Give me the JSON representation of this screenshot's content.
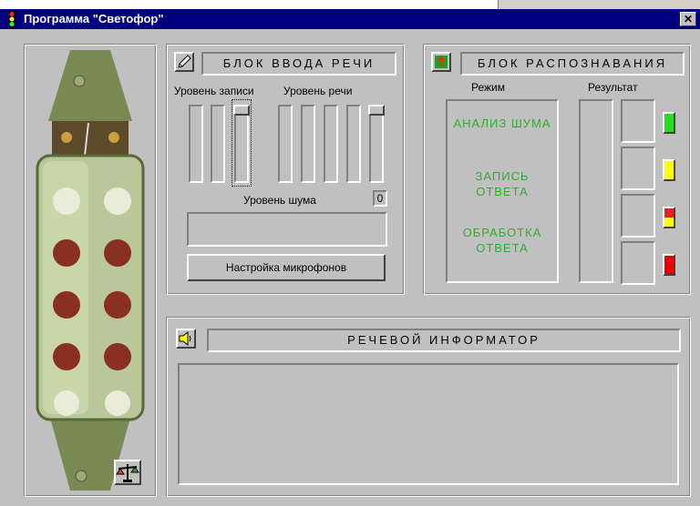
{
  "window": {
    "title": "Программа \"Светофор\"",
    "close_glyph": "✕"
  },
  "speech_input": {
    "header": "БЛОК ВВОДА РЕЧИ",
    "record_level_label": "Уровень записи",
    "speech_level_label": "Уровень речи",
    "noise_level_label": "Уровень шума",
    "noise_value": "0",
    "mic_settings_button": "Настройка микрофонов"
  },
  "recognition": {
    "header": "БЛОК РАСПОЗНАВАНИЯ",
    "mode_label": "Режим",
    "result_label": "Результат",
    "modes": [
      "АНАЛИЗ ШУМА",
      "ЗАПИСЬ ОТВЕТА",
      "ОБРАБОТКА ОТВЕТА"
    ]
  },
  "informer": {
    "header": "РЕЧЕВОЙ ИНФОРМАТОР"
  },
  "colors": {
    "titlebar": "#000080",
    "mode_text": "#33aa33",
    "lamp_green": "#22dd22",
    "lamp_yellow": "#ffff00",
    "lamp_red_yellow": "#e82020",
    "lamp_red": "#e80000"
  },
  "icons": [
    "traffic-light-icon",
    "pencil-icon",
    "recognition-icon",
    "speaker-icon",
    "scales-icon",
    "device-image"
  ]
}
